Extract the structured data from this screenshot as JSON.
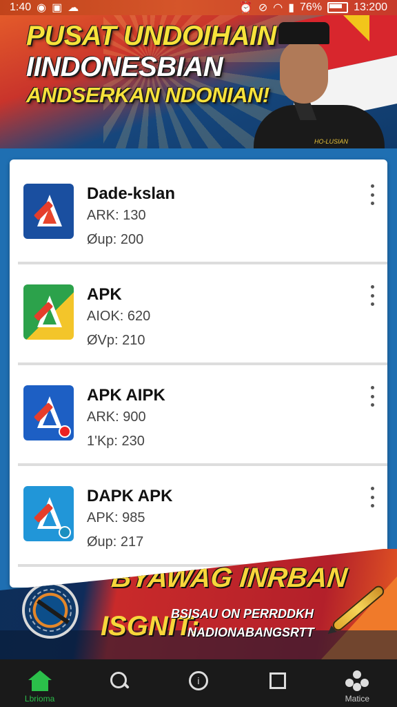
{
  "status_bar": {
    "time_left": "1:40",
    "battery_pct": "76%",
    "time_right": "13:200"
  },
  "banner": {
    "line1": "PUSAT UNDOIHAIN",
    "line2": "IINDONESBIAN",
    "line3": "ANDSERKAN NDONIAN!",
    "shirt_badge": "HO-LUSIAN"
  },
  "apps": [
    {
      "name": "Dade-kslan",
      "ark": "ARK: 130",
      "sub": "Øup: 200",
      "icon_bg": "#1a4fa0",
      "icon_accent": "#e8452c"
    },
    {
      "name": "APK",
      "ark": "AIOK: 620",
      "sub": "ØVp: 210",
      "icon_bg": "#2ca24b",
      "icon_accent": "#f3c52a"
    },
    {
      "name": "APK AIPK",
      "ark": "ARK: 900",
      "sub": "1'Kp: 230",
      "icon_bg": "#1d5fc4",
      "icon_accent": "#e43a2a"
    },
    {
      "name": "DAPK APK",
      "ark": "APK: 985",
      "sub": "Øup: 217",
      "icon_bg": "#2196d8",
      "icon_accent": "#e8452c"
    }
  ],
  "promo": {
    "title": "BYAWAG INRBAN",
    "lead": "ISGNIT:",
    "sub1": "BSISAU ON PERRDDKH",
    "sub2": "NADIONABANGSRTT"
  },
  "nav": {
    "items": [
      {
        "icon": "home-icon",
        "label": "Lbrioma"
      },
      {
        "icon": "search-icon",
        "label": ""
      },
      {
        "icon": "info-circle-icon",
        "label": ""
      },
      {
        "icon": "square-icon",
        "label": ""
      },
      {
        "icon": "more-icon",
        "label": "Matice"
      }
    ],
    "active_color": "#2bbf4a"
  },
  "colors": {
    "banner_yellow": "#f7e23b",
    "promo_red": "#c92a2a",
    "list_bg": "#ffffff",
    "nav_bg": "#1a1a1a"
  }
}
